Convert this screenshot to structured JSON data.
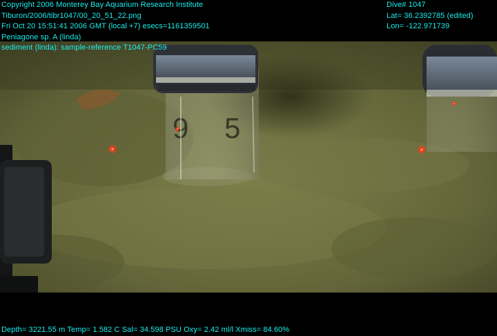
{
  "overlay": {
    "copyright": "Copyright 2006 Monterey Bay Aquarium Research Institute",
    "file": "Tiburon/2006/tibr1047/00_20_51_22.png",
    "datetime": "Fri Oct 20 15:51:41 2006 GMT (local +7)  esecs=1161359501",
    "species": "Peniagone sp. A (linda)",
    "sample": "sediment (linda): sample-reference T1047-PC59",
    "dive": "Dive# 1047",
    "lat": "Lat= 36.2392785 (edited)",
    "lon": "Lon= -122.971739",
    "telemetry": "Depth= 3221.55 m  Temp= 1.582 C  Sal= 34.598 PSU  Oxy= 2.42 ml/l  Xmiss= 84.60%"
  },
  "colors": {
    "overlay_text": "#19f0ee",
    "sediment": "#6b6d3e",
    "laser": "#ff3a1a"
  }
}
